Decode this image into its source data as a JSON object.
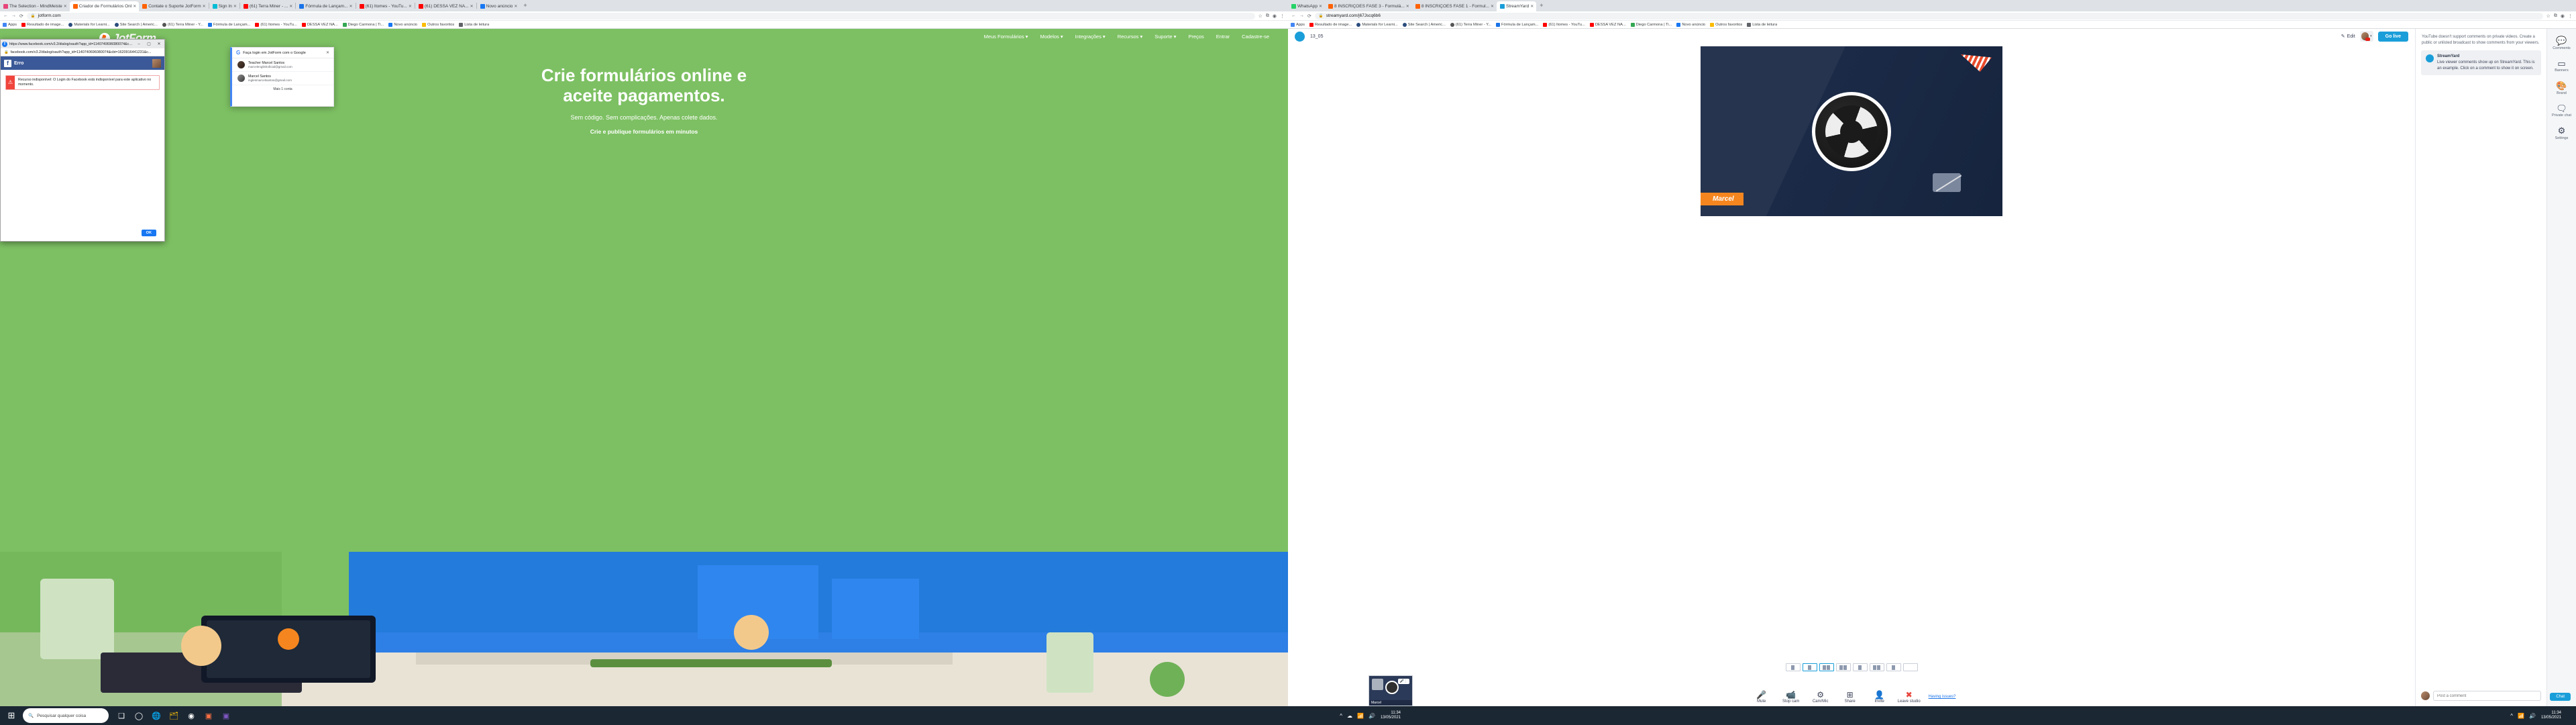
{
  "left_window": {
    "tabs": [
      {
        "title": "The Selection - MindMeiste",
        "color": "#e8457a",
        "active": false
      },
      {
        "title": "Criador de Formulários Onl",
        "color": "#ff6100",
        "active": true
      },
      {
        "title": "Contate o Suporte JotForm",
        "color": "#ff6100",
        "active": false
      },
      {
        "title": "Sign In",
        "color": "#00bcd4",
        "active": false
      },
      {
        "title": "(61) Terra Miner - ...",
        "color": "#ff0000",
        "active": false
      },
      {
        "title": "Fórmula de Lançam...",
        "color": "#1a73e8",
        "active": false
      },
      {
        "title": "(61) Itomes - YouTu...",
        "color": "#ff0000",
        "active": false
      },
      {
        "title": "(61) DESSA VEZ NÃ...",
        "color": "#ff0000",
        "active": false
      },
      {
        "title": "Novo anúncio",
        "color": "#1877f2",
        "active": false
      }
    ],
    "omnibox": {
      "url": "jotform.com",
      "lock": "secure-lock"
    },
    "bookmarks": [
      {
        "label": "Apps",
        "color": "#4285f4"
      },
      {
        "label": "Resultado de image...",
        "color": "#ff0000"
      },
      {
        "label": "Materials for Learni...",
        "color": "#2b4c7e"
      },
      {
        "label": "Site Search | Americ...",
        "color": "#2b4c7e"
      },
      {
        "label": "(61) Terra Miner - Y...",
        "color": "#ff0000"
      },
      {
        "label": "Fórmula de Lançam...",
        "color": "#1a73e8"
      },
      {
        "label": "(61) Itomes - YouTu...",
        "color": "#ff0000"
      },
      {
        "label": "DESSA VEZ NÃ...",
        "color": "#ff0000"
      },
      {
        "label": "Diego Carmona | Ti...",
        "color": "#34a853"
      },
      {
        "label": "Novo anúncio",
        "color": "#1877f2"
      },
      {
        "label": "Outros favoritos",
        "color": "#fbbc04"
      },
      {
        "label": "Lista de leitura",
        "color": "#5f6368"
      }
    ]
  },
  "jotform": {
    "logo_text": "JotForm",
    "nav": [
      "Meus Formulários ▾",
      "Modelos ▾",
      "Integrações ▾",
      "Recursos ▾",
      "Suporte ▾",
      "Preços",
      "Entrar",
      "Cadastre-se"
    ],
    "hero_line1": "Crie formulários online e",
    "hero_line2": "aceite pagamentos.",
    "hero_sub": "Sem código. Sem complicações. Apenas colete dados.",
    "subtitle": "Crie e publique formulários em minutos"
  },
  "facebook_popup": {
    "window_title": "https://www.facebook.com/v3.2/dialog/oauth?app_id=1140740696080074&cbt=...",
    "address": "facebook.com/v3.2/dialog/oauth?app_id=1140740696080074&cbt=1620916441231&c...",
    "brand_mark": "f",
    "page_title": "Erro",
    "error_text": "Recurso indisponível: O Login do Facebook está indisponível para este aplicativo no momento.",
    "error_icon": "warning-triangle-icon",
    "ok_label": "OK",
    "minimize": "–",
    "maximize": "▢",
    "close": "✕"
  },
  "google_popup": {
    "title": "Faça login em JotForm com o Google",
    "logo": "G",
    "close": "✕",
    "accounts": [
      {
        "name": "Teacher Marcel Santos",
        "email": "marcelenglishoficial@gmail.com"
      },
      {
        "name": "Marcel Santos",
        "email": "inglesmarcelsantos@gmail.com"
      }
    ],
    "more_label": "Mais 1 conta"
  },
  "right_window": {
    "tabs": [
      {
        "title": "WhatsApp",
        "color": "#25d366",
        "active": false
      },
      {
        "title": "8 INSCRIÇÕES FASE 3 - Formulá...",
        "color": "#ff6100",
        "active": false
      },
      {
        "title": "8 INSCRIÇÕES FASE 1 - Formul...",
        "color": "#ff6100",
        "active": false
      },
      {
        "title": "StreamYard",
        "color": "#1a9ed9",
        "active": true
      }
    ],
    "omnibox": {
      "url": "streamyard.com/j67Jscq6b6"
    },
    "bookmarks": [
      {
        "label": "Apps",
        "color": "#4285f4"
      },
      {
        "label": "Resultado de image...",
        "color": "#ff0000"
      },
      {
        "label": "Materials for Learni...",
        "color": "#2b4c7e"
      },
      {
        "label": "Site Search | Americ...",
        "color": "#2b4c7e"
      },
      {
        "label": "(61) Terra Miner - Y...",
        "color": "#ff0000"
      },
      {
        "label": "Fórmula de Lançam...",
        "color": "#1a73e8"
      },
      {
        "label": "(61) Itomes - YouTu...",
        "color": "#ff0000"
      },
      {
        "label": "DESSA VEZ NÃ...",
        "color": "#ff0000"
      },
      {
        "label": "Diego Carmona | Ti...",
        "color": "#34a853"
      },
      {
        "label": "Novo anúncio",
        "color": "#1877f2"
      },
      {
        "label": "Outros favoritos",
        "color": "#fbbc04"
      },
      {
        "label": "Lista de leitura",
        "color": "#5f6368"
      }
    ]
  },
  "streamyard": {
    "broadcast_title": "13_05",
    "edit_label": "Edit",
    "go_live_label": "Go live",
    "stage_name_banner": "Marcel",
    "tile_name": "Marcel",
    "tile_label": "bb",
    "controls": [
      {
        "label": "Mute",
        "icon": "microphone-icon"
      },
      {
        "label": "Stop cam",
        "icon": "video-camera-icon"
      },
      {
        "label": "Cam/Mic",
        "icon": "gear-icon"
      },
      {
        "label": "Share",
        "icon": "screen-share-icon"
      },
      {
        "label": "Invite",
        "icon": "add-person-icon"
      },
      {
        "label": "Leave studio",
        "icon": "leave-icon"
      }
    ],
    "having_issues": "Having issues?",
    "comments_notice": "YouTube doesn't support comments on private videos. Create a public or unlisted broadcast to show comments from your viewers.",
    "example_comment": {
      "author": "StreamYard",
      "body": "Live viewer comments show up on StreamYard. This is an example. Click on a comment to show it on screen."
    },
    "comment_placeholder": "Post a comment",
    "chat_label": "Chat",
    "rail": [
      {
        "label": "Comments",
        "icon": "comment-icon"
      },
      {
        "label": "Banners",
        "icon": "banner-icon"
      },
      {
        "label": "Brand",
        "icon": "palette-icon"
      },
      {
        "label": "Private chat",
        "icon": "private-chat-icon"
      },
      {
        "label": "Settings",
        "icon": "settings-gear-icon"
      }
    ]
  },
  "taskbar": {
    "search_placeholder": "Pesquisar qualquer coisa",
    "search_icon": "magnifier-icon",
    "start_icon": "windows-icon",
    "clock_time": "11:34",
    "clock_date": "13/05/2021",
    "clock_time_right": "11:34",
    "clock_date_right": "13/05/2021"
  }
}
